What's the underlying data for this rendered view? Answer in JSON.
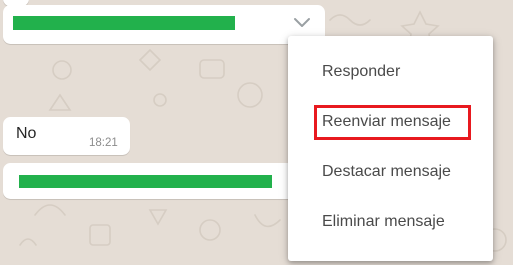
{
  "messages": [
    {
      "text": "No",
      "time": "18:21"
    }
  ],
  "context_menu": {
    "items": [
      {
        "label": "Responder"
      },
      {
        "label": "Reenviar mensaje"
      },
      {
        "label": "Destacar mensaje"
      },
      {
        "label": "Eliminar mensaje"
      }
    ],
    "highlighted_index": 1
  },
  "colors": {
    "chat_background": "#e5ddd5",
    "bubble": "#ffffff",
    "redaction": "#22b14c",
    "highlight": "#e8191f"
  },
  "icons": {
    "menu_trigger": "chevron-down-icon"
  }
}
